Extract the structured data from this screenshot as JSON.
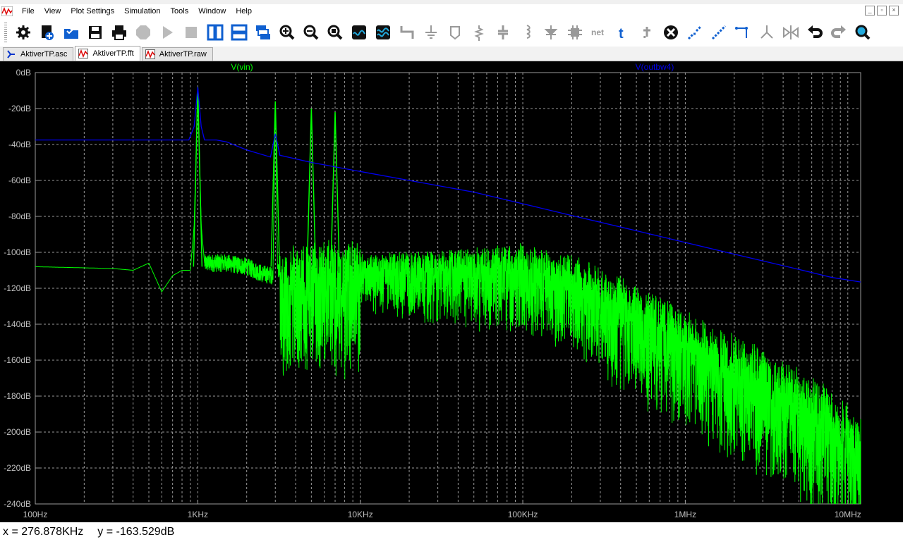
{
  "menu": {
    "items": [
      "File",
      "View",
      "Plot Settings",
      "Simulation",
      "Tools",
      "Window",
      "Help"
    ]
  },
  "toolbar": {
    "buttons": [
      "gear-icon",
      "open-schematic-icon",
      "open-folder-icon",
      "save-icon",
      "print-icon",
      "halt-icon",
      "run-icon",
      "stop-icon",
      "tile-vertical-icon",
      "tile-horizontal-icon",
      "cascade-icon",
      "zoom-in-icon",
      "zoom-out-icon",
      "zoom-fit-icon",
      "autorange-icon",
      "waveform-icon",
      "wire-icon",
      "ground-icon",
      "label-icon",
      "resistor-icon",
      "capacitor-icon",
      "inductor-icon",
      "diode-icon",
      "component-icon",
      "net-label-icon",
      "text-icon",
      "spice-directive-icon",
      "delete-icon",
      "duplicate-icon",
      "move-icon",
      "drag-icon",
      "rotate-icon",
      "mirror-icon",
      "undo-icon",
      "redo-icon",
      "find-icon"
    ]
  },
  "tabs": [
    {
      "label": "AktiverTP.asc",
      "icon": "schematic-icon",
      "active": false
    },
    {
      "label": "AktiverTP.fft",
      "icon": "waveform-icon",
      "active": true
    },
    {
      "label": "AktiverTP.raw",
      "icon": "waveform-icon",
      "active": false
    }
  ],
  "status": {
    "x_readout": "x = 276.878KHz",
    "y_readout": "y = -163.529dB"
  },
  "colors": {
    "plot_bg": "#000000",
    "grid": "#9a9a9a",
    "trace_vin": "#00ff00",
    "trace_outbw4": "#0000ee",
    "axis_text": "#c0c0c0"
  },
  "chart_data": {
    "type": "line",
    "x_scale": "log",
    "xlim": [
      100,
      12000000
    ],
    "ylim": [
      -240,
      0
    ],
    "x_ticks": [
      100,
      1000,
      10000,
      100000,
      1000000,
      10000000
    ],
    "x_tick_labels": [
      "100Hz",
      "1KHz",
      "10KHz",
      "100KHz",
      "1MHz",
      "10MHz"
    ],
    "y_ticks": [
      0,
      -20,
      -40,
      -60,
      -80,
      -100,
      -120,
      -140,
      -160,
      -180,
      -200,
      -220,
      -240
    ],
    "y_tick_labels": [
      "0dB",
      "-20dB",
      "-40dB",
      "-60dB",
      "-80dB",
      "-100dB",
      "-120dB",
      "-140dB",
      "-160dB",
      "-180dB",
      "-200dB",
      "-220dB",
      "-240dB"
    ],
    "grid": true,
    "series": [
      {
        "name": "V(vin)",
        "color": "#00ff00",
        "envelope": [
          [
            100,
            -108
          ],
          [
            300,
            -109
          ],
          [
            400,
            -110
          ],
          [
            500,
            -106
          ],
          [
            600,
            -122
          ],
          [
            700,
            -113
          ],
          [
            800,
            -110
          ],
          [
            900,
            -110
          ],
          [
            950,
            -85
          ],
          [
            1000,
            -8
          ],
          [
            1050,
            -85
          ],
          [
            1100,
            -106
          ],
          [
            1500,
            -106
          ],
          [
            2000,
            -108
          ],
          [
            2500,
            -112
          ],
          [
            2900,
            -113
          ],
          [
            3000,
            -16
          ],
          [
            3100,
            -110
          ],
          [
            5000,
            -108
          ],
          [
            7000,
            -106
          ],
          [
            10000,
            -107
          ],
          [
            20000,
            -106
          ],
          [
            40000,
            -106
          ],
          [
            100000,
            -104
          ],
          [
            200000,
            -112
          ],
          [
            400000,
            -125
          ],
          [
            1000000,
            -145
          ],
          [
            2000000,
            -158
          ],
          [
            4000000,
            -173
          ],
          [
            8000000,
            -190
          ],
          [
            12000000,
            -205
          ]
        ],
        "spikes": [
          [
            1000,
            -8
          ],
          [
            3000,
            -16
          ],
          [
            5000,
            -20
          ],
          [
            7000,
            -22
          ]
        ],
        "noise_spread_db": [
          [
            10000,
            25
          ],
          [
            100000,
            40
          ],
          [
            1000000,
            55
          ],
          [
            12000000,
            60
          ]
        ]
      },
      {
        "name": "V(outbw4)",
        "color": "#0000ee",
        "values": [
          [
            100,
            -37.5
          ],
          [
            880,
            -37.5
          ],
          [
            950,
            -30
          ],
          [
            1000,
            -8
          ],
          [
            1050,
            -30
          ],
          [
            1100,
            -37.5
          ],
          [
            1300,
            -37.5
          ],
          [
            1500,
            -38.5
          ],
          [
            2000,
            -43
          ],
          [
            2800,
            -47
          ],
          [
            3000,
            -34
          ],
          [
            3200,
            -46
          ],
          [
            5000,
            -50
          ],
          [
            10000,
            -55
          ],
          [
            20000,
            -60
          ],
          [
            50000,
            -66.5
          ],
          [
            100000,
            -73
          ],
          [
            200000,
            -79.5
          ],
          [
            500000,
            -88
          ],
          [
            1000000,
            -94.5
          ],
          [
            2000000,
            -101
          ],
          [
            5000000,
            -109.5
          ],
          [
            8000000,
            -114
          ],
          [
            12000000,
            -116.5
          ]
        ]
      }
    ]
  }
}
